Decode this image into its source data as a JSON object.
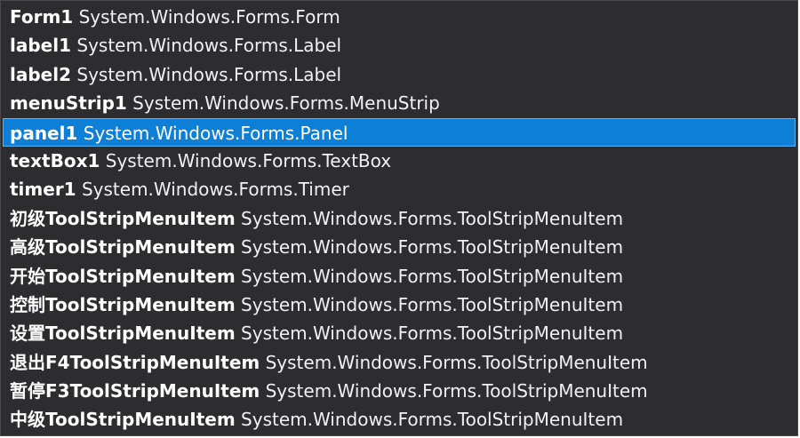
{
  "completion_list": {
    "selected_index": 4,
    "items": [
      {
        "name": "Form1",
        "type": "System.Windows.Forms.Form"
      },
      {
        "name": "label1",
        "type": "System.Windows.Forms.Label"
      },
      {
        "name": "label2",
        "type": "System.Windows.Forms.Label"
      },
      {
        "name": "menuStrip1",
        "type": "System.Windows.Forms.MenuStrip"
      },
      {
        "name": "panel1",
        "type": "System.Windows.Forms.Panel"
      },
      {
        "name": "textBox1",
        "type": "System.Windows.Forms.TextBox"
      },
      {
        "name": "timer1",
        "type": "System.Windows.Forms.Timer"
      },
      {
        "name": "初级ToolStripMenuItem",
        "type": "System.Windows.Forms.ToolStripMenuItem"
      },
      {
        "name": "高级ToolStripMenuItem",
        "type": "System.Windows.Forms.ToolStripMenuItem"
      },
      {
        "name": "开始ToolStripMenuItem",
        "type": "System.Windows.Forms.ToolStripMenuItem"
      },
      {
        "name": "控制ToolStripMenuItem",
        "type": "System.Windows.Forms.ToolStripMenuItem"
      },
      {
        "name": "设置ToolStripMenuItem",
        "type": "System.Windows.Forms.ToolStripMenuItem"
      },
      {
        "name": "退出F4ToolStripMenuItem",
        "type": "System.Windows.Forms.ToolStripMenuItem"
      },
      {
        "name": "暂停F3ToolStripMenuItem",
        "type": "System.Windows.Forms.ToolStripMenuItem"
      },
      {
        "name": "中级ToolStripMenuItem",
        "type": "System.Windows.Forms.ToolStripMenuItem"
      }
    ]
  },
  "colors": {
    "background": "#2d2d30",
    "selection": "#0e7fd6",
    "text": "#f1f1f1"
  }
}
